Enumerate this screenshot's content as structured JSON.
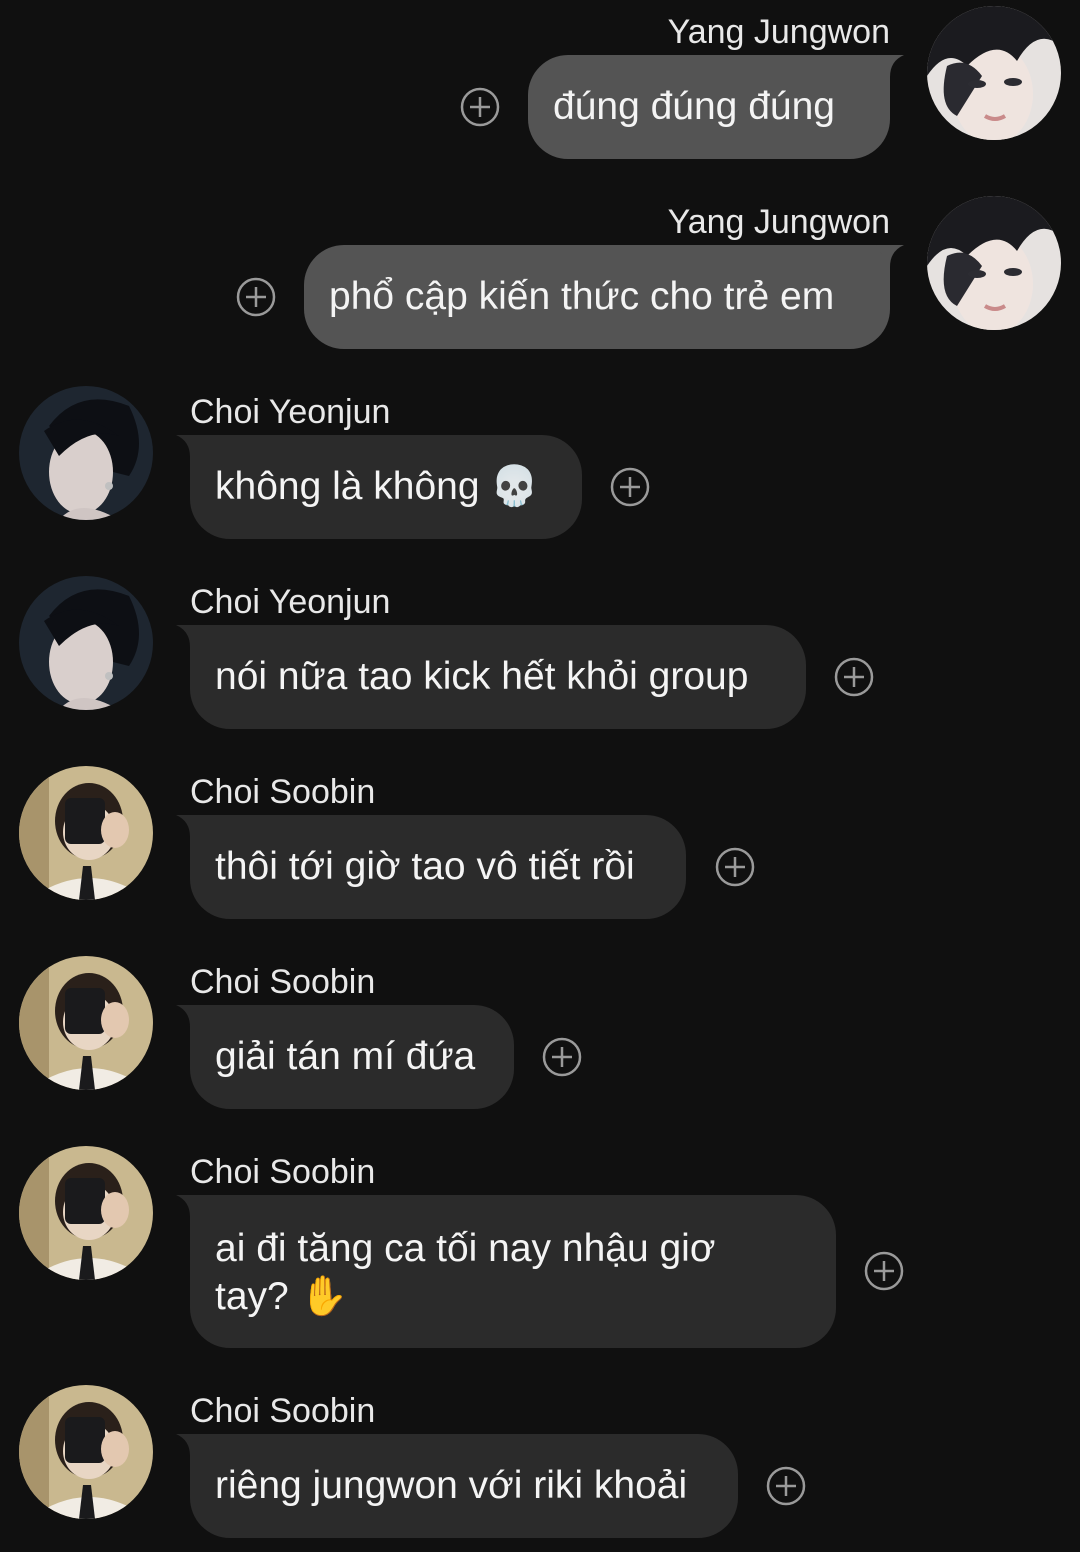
{
  "messages": [
    {
      "sender": "Yang Jungwon",
      "text": "đúng đúng đúng",
      "direction": "out"
    },
    {
      "sender": "Yang Jungwon",
      "text": "phổ cập kiến thức cho trẻ em",
      "direction": "out"
    },
    {
      "sender": "Choi Yeonjun",
      "text": "không là không 💀",
      "direction": "in"
    },
    {
      "sender": "Choi Yeonjun",
      "text": "nói nữa tao kick hết khỏi group",
      "direction": "in"
    },
    {
      "sender": "Choi Soobin",
      "text": "thôi tới giờ tao vô tiết rồi",
      "direction": "in"
    },
    {
      "sender": "Choi Soobin",
      "text": "giải tán mí đứa",
      "direction": "in"
    },
    {
      "sender": "Choi Soobin",
      "text": "ai đi tăng ca tối nay nhậu giơ tay? ✋",
      "direction": "in"
    },
    {
      "sender": "Choi Soobin",
      "text": "riêng jungwon với riki khoải",
      "direction": "in"
    }
  ],
  "icons": {
    "react": "add-reaction-icon"
  },
  "colors": {
    "background": "#101010",
    "outgoing_bubble": "#545454",
    "incoming_bubble": "#2b2b2b",
    "text": "#f4f4f4",
    "name": "#e8e8e8",
    "icon": "#9a9a9a"
  }
}
